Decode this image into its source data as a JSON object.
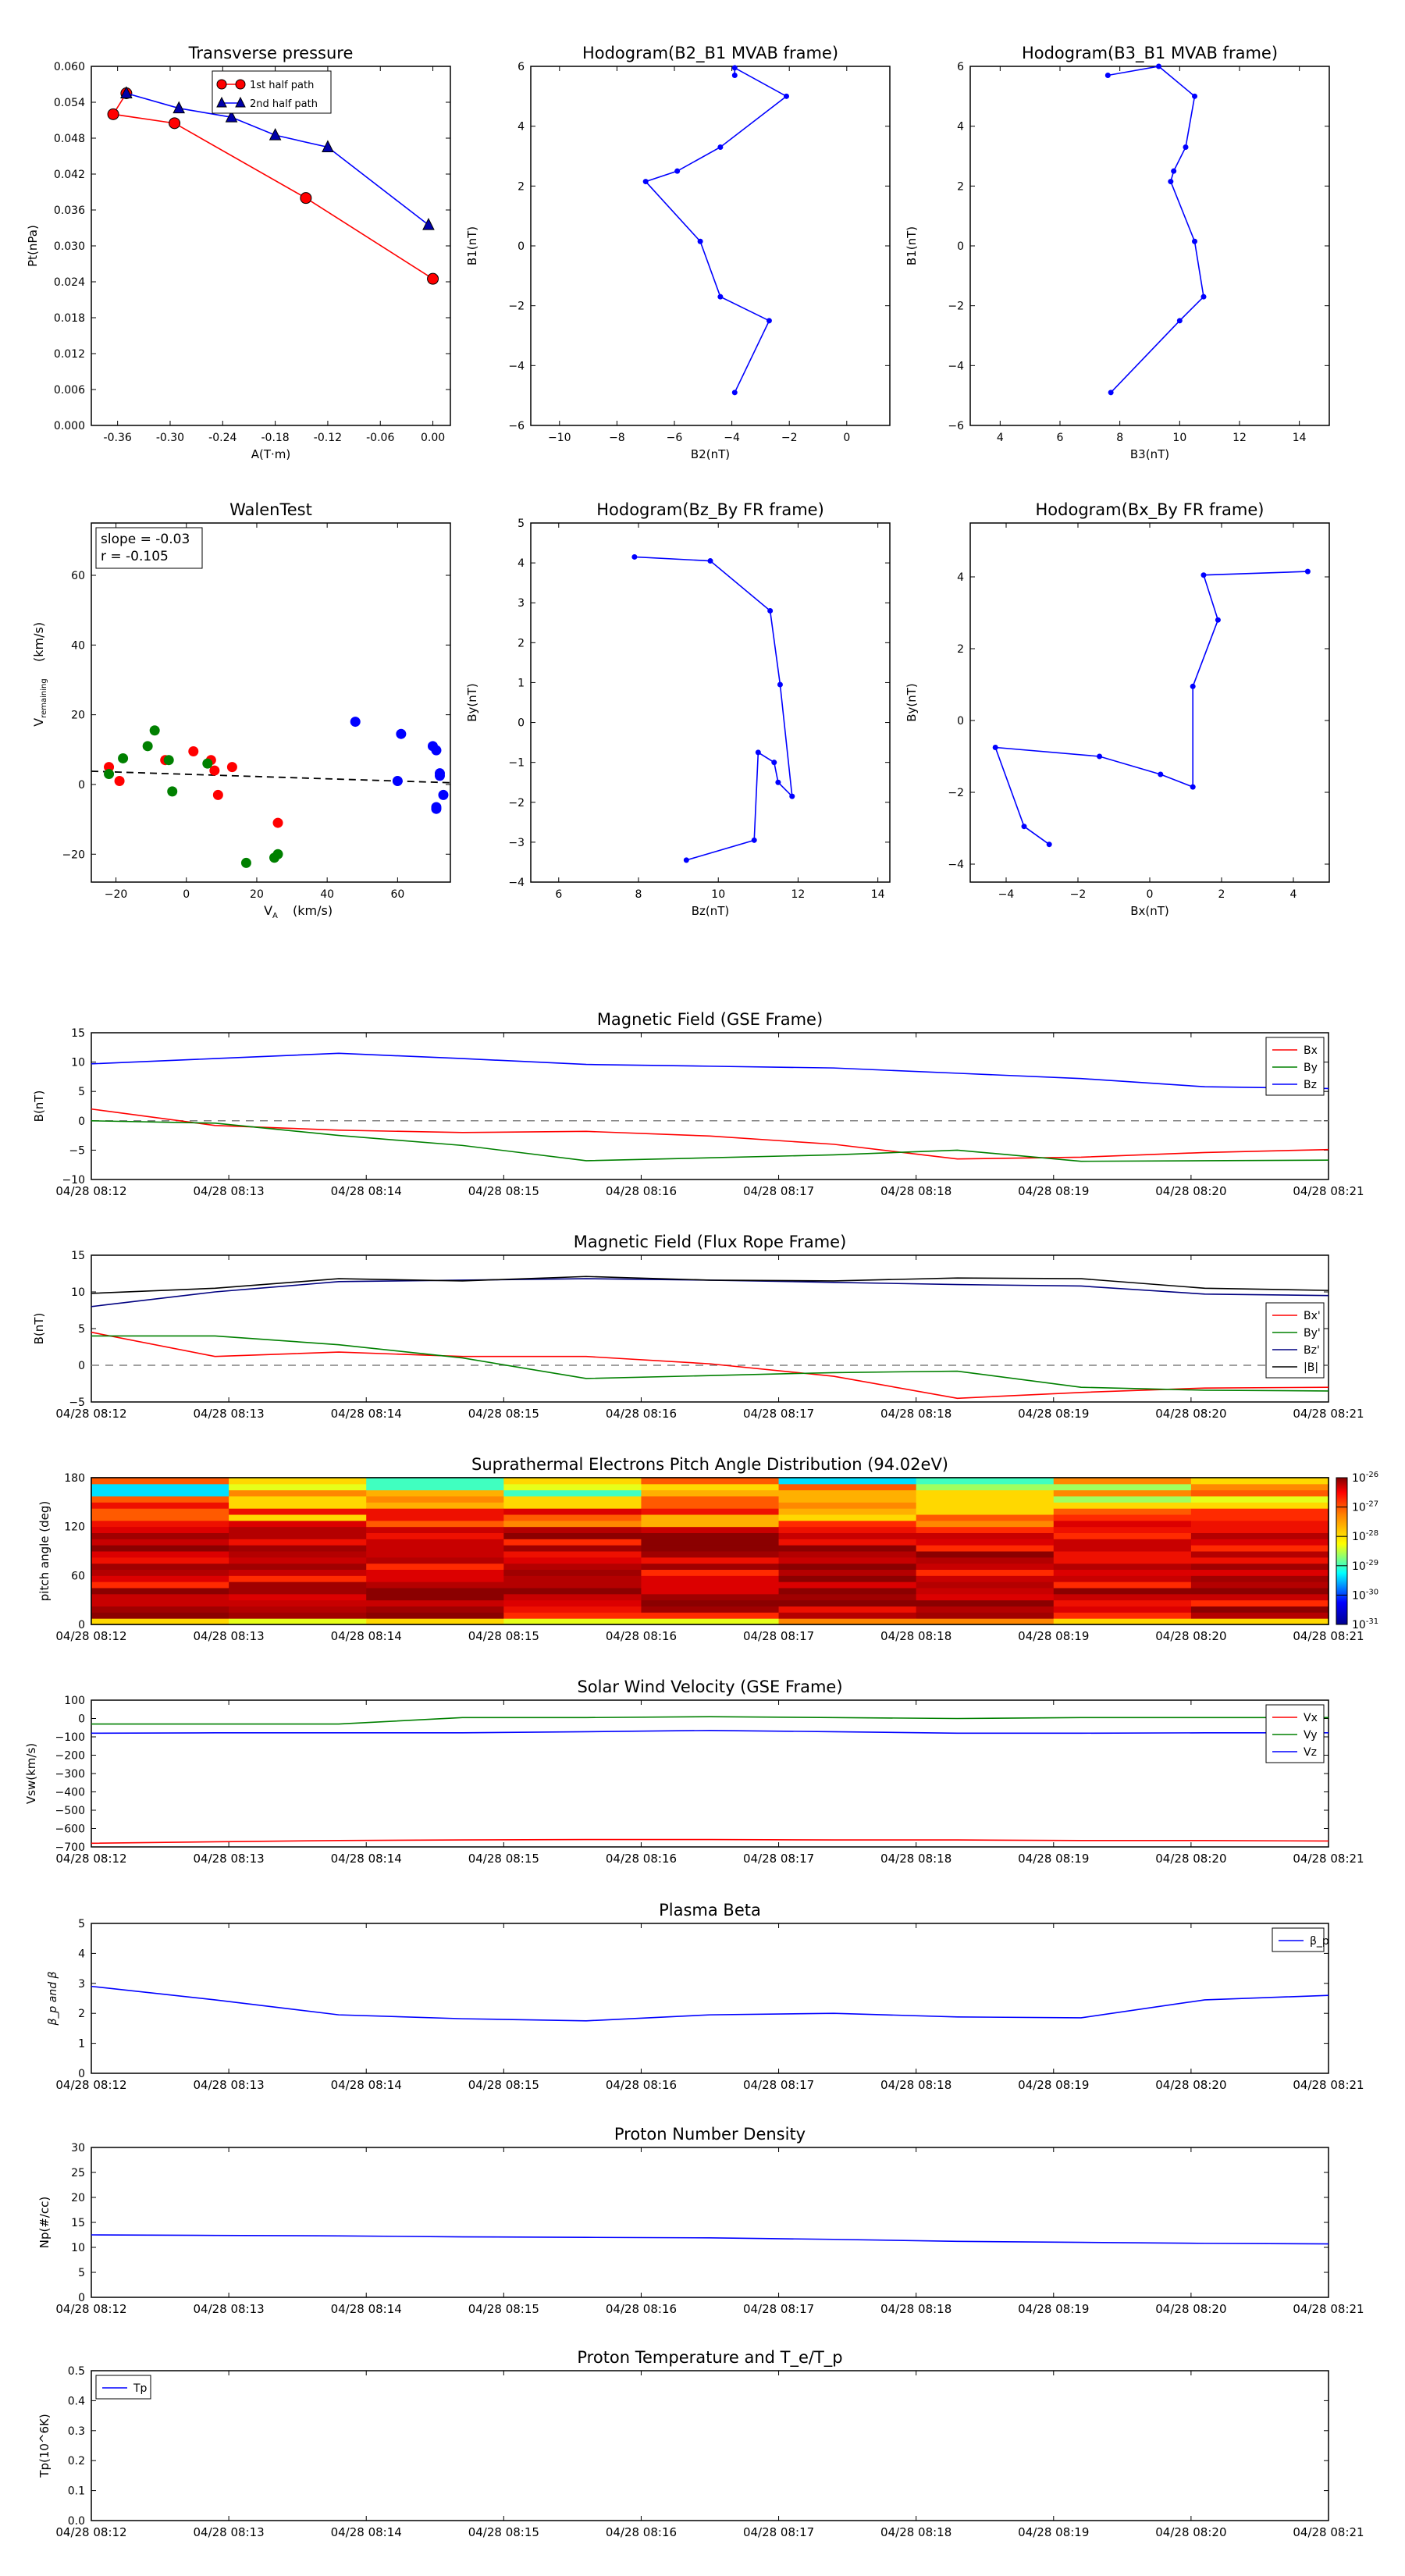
{
  "times": [
    "04/28 08:12",
    "04/28 08:13",
    "04/28 08:14",
    "04/28 08:15",
    "04/28 08:16",
    "04/28 08:17",
    "04/28 08:18",
    "04/28 08:19",
    "04/28 08:20",
    "04/28 08:21"
  ],
  "colors": {
    "red": "#ff0000",
    "green": "#008000",
    "blue": "#0000ff",
    "navy": "#000080",
    "black": "#000000",
    "grey": "#808080"
  },
  "chart_data": [
    {
      "id": "transverse-pressure",
      "type": "line",
      "title": "Transverse pressure",
      "xlabel": "A(T·m)",
      "ylabel": "Pt(nPa)",
      "xlim": [
        -0.39,
        0.02
      ],
      "ylim": [
        0.0,
        0.06
      ],
      "xticks": [
        -0.36,
        -0.3,
        -0.24,
        -0.18,
        -0.12,
        -0.06,
        0.0
      ],
      "yticks": [
        0.0,
        0.006,
        0.012,
        0.018,
        0.024,
        0.03,
        0.036,
        0.042,
        0.048,
        0.054,
        0.06
      ],
      "xtick_labels": [
        "-0.36",
        "-0.30",
        "-0.24",
        "-0.18",
        "-0.12",
        "-0.06",
        "0.00"
      ],
      "ytick_labels": [
        "0.000",
        "0.006",
        "0.012",
        "0.018",
        "0.024",
        "0.030",
        "0.036",
        "0.042",
        "0.048",
        "0.054",
        "0.060"
      ],
      "legend": "top-center",
      "series": [
        {
          "name": "1st half path",
          "color": "#ff0000",
          "marker": "circle",
          "x": [
            0.0,
            -0.145,
            -0.295,
            -0.365,
            -0.35
          ],
          "y": [
            0.0245,
            0.038,
            0.0505,
            0.052,
            0.0555
          ]
        },
        {
          "name": "2nd half path",
          "color": "#0000ff",
          "marker": "triangle",
          "x": [
            -0.35,
            -0.29,
            -0.23,
            -0.18,
            -0.12,
            -0.005
          ],
          "y": [
            0.0555,
            0.053,
            0.0515,
            0.0485,
            0.0465,
            0.0335
          ]
        }
      ]
    },
    {
      "id": "hodogram-b2-b1",
      "type": "line",
      "title": "Hodogram(B2_B1 MVAB frame)",
      "xlabel": "B2(nT)",
      "ylabel": "B1(nT)",
      "xlim": [
        -11,
        1.5
      ],
      "ylim": [
        -6,
        6
      ],
      "xticks": [
        -10,
        -8,
        -6,
        -4,
        -2,
        0
      ],
      "yticks": [
        -6,
        -4,
        -2,
        0,
        2,
        4,
        6
      ],
      "xtick_labels": [
        "−10",
        "−8",
        "−6",
        "−4",
        "−2",
        "0"
      ],
      "ytick_labels": [
        "−6",
        "−4",
        "−2",
        "0",
        "2",
        "4",
        "6"
      ],
      "series": [
        {
          "name": "",
          "color": "#0000ff",
          "marker": "dot",
          "x": [
            -3.9,
            -2.7,
            -4.4,
            -5.1,
            -7.0,
            -5.9,
            -4.4,
            -2.1,
            -3.9,
            -3.9
          ],
          "y": [
            -4.9,
            -2.5,
            -1.7,
            0.15,
            2.15,
            2.5,
            3.3,
            5.0,
            5.95,
            5.7
          ]
        }
      ]
    },
    {
      "id": "hodogram-b3-b1",
      "type": "line",
      "title": "Hodogram(B3_B1 MVAB frame)",
      "xlabel": "B3(nT)",
      "ylabel": "B1(nT)",
      "xlim": [
        3,
        15
      ],
      "ylim": [
        -6,
        6
      ],
      "xticks": [
        4,
        6,
        8,
        10,
        12,
        14
      ],
      "yticks": [
        -6,
        -4,
        -2,
        0,
        2,
        4,
        6
      ],
      "xtick_labels": [
        "4",
        "6",
        "8",
        "10",
        "12",
        "14"
      ],
      "ytick_labels": [
        "−6",
        "−4",
        "−2",
        "0",
        "2",
        "4",
        "6"
      ],
      "series": [
        {
          "name": "",
          "color": "#0000ff",
          "marker": "dot",
          "x": [
            7.7,
            10.0,
            10.8,
            10.5,
            9.7,
            9.8,
            10.2,
            10.5,
            9.3,
            7.6
          ],
          "y": [
            -4.9,
            -2.5,
            -1.7,
            0.15,
            2.15,
            2.5,
            3.3,
            5.0,
            6.0,
            5.7
          ]
        }
      ]
    },
    {
      "id": "walen-test",
      "type": "scatter",
      "title": "WalenTest",
      "xlabel": "V_A(km/s)",
      "ylabel": "V_remaining(km/s)",
      "xlim": [
        -27,
        75
      ],
      "ylim": [
        -28,
        75
      ],
      "xticks": [
        -20,
        0,
        20,
        40,
        60
      ],
      "yticks": [
        -20,
        0,
        20,
        40,
        60
      ],
      "xtick_labels": [
        "−20",
        "0",
        "20",
        "40",
        "60"
      ],
      "ytick_labels": [
        "−20",
        "0",
        "20",
        "40",
        "60"
      ],
      "annotation": [
        "slope = -0.03",
        "r = -0.105"
      ],
      "fit_line": {
        "x": [
          -27,
          75
        ],
        "y": [
          3.8,
          0.5
        ]
      },
      "series": [
        {
          "name": "",
          "color": "#ff0000",
          "x": [
            -22,
            -19,
            -6,
            2,
            8,
            9,
            13,
            26,
            7
          ],
          "y": [
            5,
            1,
            7,
            9.5,
            4,
            -3,
            5,
            -11,
            7
          ]
        },
        {
          "name": "",
          "color": "#008000",
          "x": [
            -22,
            -18,
            -11,
            -9,
            -5,
            -4,
            6,
            17,
            25,
            26
          ],
          "y": [
            3,
            7.5,
            11,
            15.5,
            7,
            -2,
            6,
            -22.5,
            -21,
            -20
          ]
        },
        {
          "name": "",
          "color": "#0000ff",
          "x": [
            48,
            61,
            60,
            70,
            71,
            72,
            72,
            73,
            71,
            71
          ],
          "y": [
            18,
            14.5,
            1,
            11,
            9.8,
            3.2,
            2.5,
            -3,
            -7,
            -6.5
          ]
        }
      ]
    },
    {
      "id": "hodogram-bz-by",
      "type": "line",
      "title": "Hodogram(Bz_By FR frame)",
      "xlabel": "Bz(nT)",
      "ylabel": "By(nT)",
      "xlim": [
        5.3,
        14.3
      ],
      "ylim": [
        -4,
        5
      ],
      "xticks": [
        6,
        8,
        10,
        12,
        14
      ],
      "yticks": [
        -4,
        -3,
        -2,
        -1,
        0,
        1,
        2,
        3,
        4,
        5
      ],
      "xtick_labels": [
        "6",
        "8",
        "10",
        "12",
        "14"
      ],
      "ytick_labels": [
        "−4",
        "−3",
        "−2",
        "−1",
        "0",
        "1",
        "2",
        "3",
        "4",
        "5"
      ],
      "series": [
        {
          "name": "",
          "color": "#0000ff",
          "marker": "dot",
          "x": [
            9.2,
            10.9,
            11.0,
            11.4,
            11.5,
            11.85,
            11.55,
            11.3,
            9.8,
            7.9
          ],
          "y": [
            -3.45,
            -2.95,
            -0.75,
            -1.0,
            -1.5,
            -1.85,
            0.95,
            2.8,
            4.05,
            4.15
          ]
        }
      ]
    },
    {
      "id": "hodogram-bx-by",
      "type": "line",
      "title": "Hodogram(Bx_By FR frame)",
      "xlabel": "Bx(nT)",
      "ylabel": "By(nT)",
      "xlim": [
        -5,
        5
      ],
      "ylim": [
        -4.5,
        5.5
      ],
      "xticks": [
        -4,
        -2,
        0,
        2,
        4
      ],
      "yticks": [
        -4,
        -2,
        0,
        2,
        4
      ],
      "xtick_labels": [
        "−4",
        "−2",
        "0",
        "2",
        "4"
      ],
      "ytick_labels": [
        "−4",
        "−2",
        "0",
        "2",
        "4"
      ],
      "series": [
        {
          "name": "",
          "color": "#0000ff",
          "marker": "dot",
          "x": [
            -2.8,
            -3.5,
            -4.3,
            -1.4,
            0.3,
            1.2,
            1.2,
            1.9,
            1.5,
            4.4
          ],
          "y": [
            -3.45,
            -2.95,
            -0.75,
            -1.0,
            -1.5,
            -1.85,
            0.95,
            2.8,
            4.05,
            4.15
          ]
        }
      ]
    },
    {
      "id": "magnetic-field-gse",
      "type": "line",
      "title": "Magnetic Field (GSE Frame)",
      "xlabel": "",
      "ylabel": "B(nT)",
      "ylim": [
        -10,
        15
      ],
      "yticks": [
        -10,
        -5,
        0,
        5,
        10,
        15
      ],
      "ytick_labels": [
        "−10",
        "−5",
        "0",
        "5",
        "10",
        "15"
      ],
      "zero_line": true,
      "legend": "top-right",
      "series": [
        {
          "name": "Bx",
          "color": "#ff0000",
          "y": [
            2,
            -0.8,
            -1.6,
            -2.0,
            -1.8,
            -2.6,
            -4.0,
            -6.5,
            -6.2,
            -5.4,
            -4.9
          ]
        },
        {
          "name": "By",
          "color": "#008000",
          "y": [
            0,
            -0.4,
            -2.5,
            -4.2,
            -6.8,
            -6.3,
            -5.8,
            -5.0,
            -6.9,
            -6.8,
            -6.7
          ]
        },
        {
          "name": "Bz",
          "color": "#0000ff",
          "y": [
            9.7,
            10.6,
            11.5,
            10.6,
            9.6,
            9.3,
            9.0,
            8.1,
            7.2,
            5.8,
            5.5
          ]
        }
      ]
    },
    {
      "id": "magnetic-field-fr",
      "type": "line",
      "title": "Magnetic Field (Flux Rope Frame)",
      "xlabel": "",
      "ylabel": "B(nT)",
      "ylim": [
        -5,
        15
      ],
      "yticks": [
        -5,
        0,
        5,
        10,
        15
      ],
      "ytick_labels": [
        "−5",
        "0",
        "5",
        "10",
        "15"
      ],
      "zero_line": true,
      "legend": "right",
      "series": [
        {
          "name": "Bx'",
          "color": "#ff0000",
          "y": [
            4.5,
            1.2,
            1.8,
            1.2,
            1.2,
            0.2,
            -1.5,
            -4.5,
            -3.7,
            -3.1,
            -3.0
          ]
        },
        {
          "name": "By'",
          "color": "#008000",
          "y": [
            4.0,
            4.0,
            2.8,
            1.0,
            -1.8,
            -1.4,
            -1.0,
            -0.8,
            -3.0,
            -3.4,
            -3.5
          ]
        },
        {
          "name": "Bz'",
          "color": "#000080",
          "y": [
            8.0,
            10.0,
            11.4,
            11.6,
            11.8,
            11.6,
            11.3,
            11.0,
            10.8,
            9.7,
            9.5
          ]
        },
        {
          "name": "|B|",
          "color": "#000000",
          "y": [
            9.8,
            10.5,
            11.8,
            11.5,
            12.1,
            11.6,
            11.5,
            11.9,
            11.8,
            10.5,
            10.2
          ]
        }
      ]
    },
    {
      "id": "pitch-angle",
      "type": "heatmap",
      "title": "Suprathermal Electrons Pitch Angle Distribution (94.02eV)",
      "xlabel": "",
      "ylabel": "pitch angle (deg)",
      "ylim": [
        0,
        180
      ],
      "yticks": [
        0,
        60,
        120,
        180
      ],
      "ytick_labels": [
        "0",
        "60",
        "120",
        "180"
      ],
      "colorbar_labels": [
        "10^-26",
        "10^-27",
        "10^-28",
        "10^-29",
        "10^-30",
        "10^-31"
      ],
      "colorbar_exponents": [
        "-26",
        "-27",
        "-28",
        "-29",
        "-30",
        "-31"
      ]
    },
    {
      "id": "solar-wind-velocity",
      "type": "line",
      "title": "Solar Wind Velocity (GSE Frame)",
      "xlabel": "",
      "ylabel": "Vsw(km/s)",
      "ylim": [
        -700,
        100
      ],
      "yticks": [
        -700,
        -600,
        -500,
        -400,
        -300,
        -200,
        -100,
        0,
        100
      ],
      "ytick_labels": [
        "−700",
        "−600",
        "−500",
        "−400",
        "−300",
        "−200",
        "−100",
        "0",
        "100"
      ],
      "legend": "top-right",
      "series": [
        {
          "name": "Vx",
          "color": "#ff0000",
          "y": [
            -680,
            -672,
            -665,
            -662,
            -660,
            -660,
            -662,
            -662,
            -665,
            -665,
            -668
          ]
        },
        {
          "name": "Vy",
          "color": "#008000",
          "y": [
            -30,
            -30,
            -30,
            5,
            5,
            10,
            5,
            0,
            5,
            5,
            5
          ]
        },
        {
          "name": "Vz",
          "color": "#0000ff",
          "y": [
            -80,
            -78,
            -78,
            -78,
            -72,
            -65,
            -72,
            -80,
            -80,
            -78,
            -78
          ]
        }
      ]
    },
    {
      "id": "plasma-beta",
      "type": "line",
      "title": "Plasma Beta",
      "xlabel": "",
      "ylabel": "β_p and β",
      "ylim": [
        0,
        5
      ],
      "yticks": [
        0,
        1,
        2,
        3,
        4,
        5
      ],
      "ytick_labels": [
        "0",
        "1",
        "2",
        "3",
        "4",
        "5"
      ],
      "legend": "top-right",
      "series": [
        {
          "name": "β_p",
          "color": "#0000ff",
          "y": [
            2.9,
            2.45,
            1.95,
            1.82,
            1.75,
            1.95,
            2.0,
            1.88,
            1.85,
            2.45,
            2.6
          ]
        }
      ]
    },
    {
      "id": "proton-density",
      "type": "line",
      "title": "Proton Number Density",
      "xlabel": "",
      "ylabel": "Np(#/cc)",
      "ylim": [
        0,
        30
      ],
      "yticks": [
        0,
        5,
        10,
        15,
        20,
        25,
        30
      ],
      "ytick_labels": [
        "0",
        "5",
        "10",
        "15",
        "20",
        "25",
        "30"
      ],
      "series": [
        {
          "name": "",
          "color": "#0000ff",
          "y": [
            12.5,
            12.4,
            12.3,
            12.1,
            12.0,
            11.9,
            11.6,
            11.2,
            11.0,
            10.8,
            10.7
          ]
        }
      ]
    },
    {
      "id": "proton-temperature",
      "type": "line",
      "title": "Proton Temperature and T_e/T_p",
      "xlabel": "",
      "ylabel": "Tp(10^6K)",
      "ylim": [
        0,
        0.5
      ],
      "yticks": [
        0,
        0.1,
        0.2,
        0.3,
        0.4,
        0.5
      ],
      "ytick_labels": [
        "0.0",
        "0.1",
        "0.2",
        "0.3",
        "0.4",
        "0.5"
      ],
      "legend": "top-left",
      "series": [
        {
          "name": "Tp",
          "color": "#0000ff",
          "y": []
        }
      ]
    }
  ]
}
